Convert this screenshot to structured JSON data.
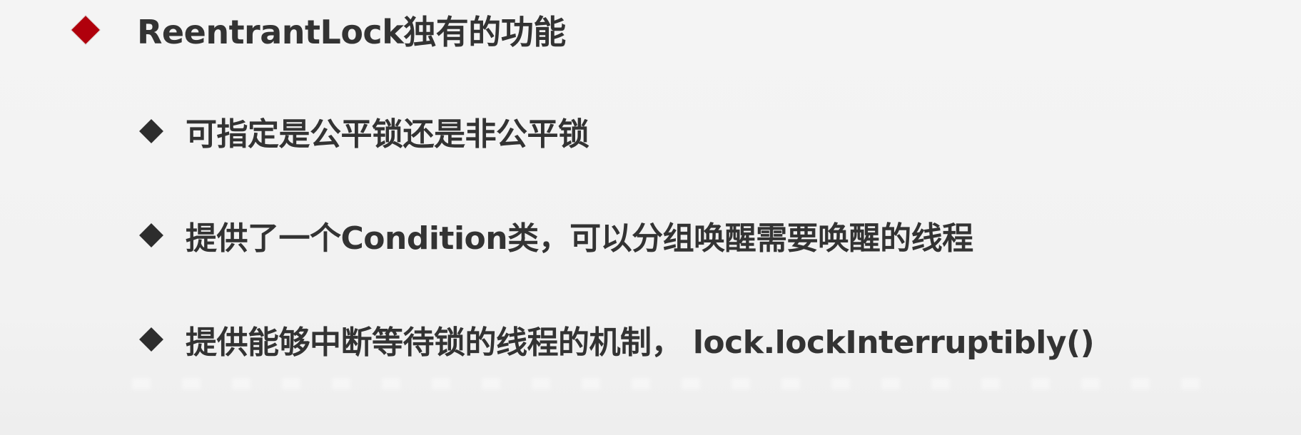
{
  "heading": {
    "text": "ReentrantLock独有的功能",
    "bullet": "red-diamond-icon"
  },
  "items": [
    {
      "text": "可指定是公平锁还是非公平锁",
      "bullet": "black-diamond-icon"
    },
    {
      "text": "提供了一个Condition类，可以分组唤醒需要唤醒的线程",
      "bullet": "black-diamond-icon"
    },
    {
      "text": "提供能够中断等待锁的线程的机制， lock.lockInterruptibly()",
      "bullet": "black-diamond-icon"
    }
  ],
  "colors": {
    "background": "#f3f3f3",
    "heading_bullet": "#b0000c",
    "item_bullet": "#2d2d2d",
    "text": "#333333"
  }
}
